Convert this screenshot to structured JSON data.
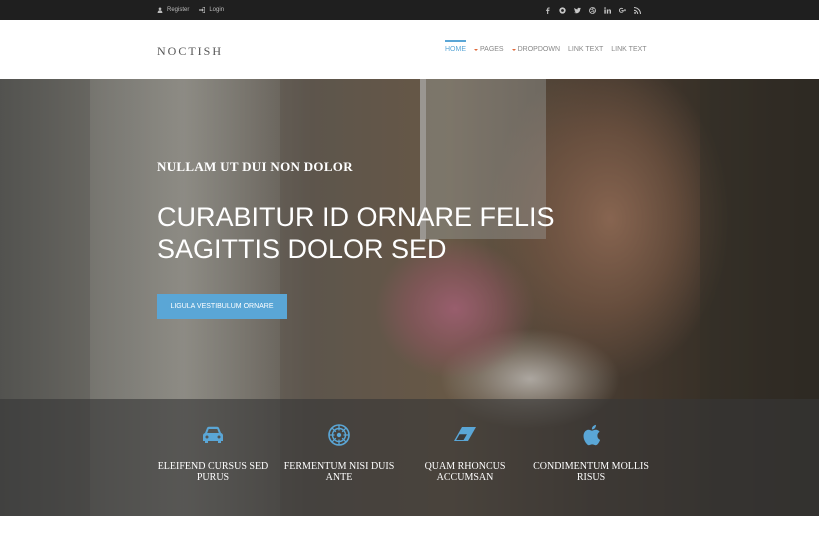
{
  "topbar": {
    "register_label": "Register",
    "login_label": "Login",
    "social_icons": [
      "facebook-icon",
      "pinterest-icon",
      "twitter-icon",
      "dribbble-icon",
      "linkedin-icon",
      "google-plus-icon",
      "rss-icon"
    ]
  },
  "header": {
    "logo": "NOCTISH",
    "nav": [
      "HOME",
      "PAGES",
      "DROPDOWN",
      "LINK TEXT",
      "LINK TEXT"
    ]
  },
  "hero": {
    "subtitle": "NULLAM UT DUI NON DOLOR",
    "headline": "CURABITUR ID ORNARE FELIS SAGITTIS DOLOR SED",
    "cta_label": "LIGULA VESTIBULUM ORNARE"
  },
  "features": [
    {
      "icon": "car-icon",
      "title": "ELEIFEND CURSUS SED PURUS"
    },
    {
      "icon": "empire-icon",
      "title": "FERMENTUM NISI DUIS ANTE"
    },
    {
      "icon": "eraser-icon",
      "title": "QUAM RHONCUS ACCUMSAN"
    },
    {
      "icon": "apple-icon",
      "title": "CONDIMENTUM MOLLIS RISUS"
    }
  ],
  "colors": {
    "accent": "#5aa6d6",
    "topbar_bg": "#1f1f1f",
    "caret": "#e06a3b"
  }
}
